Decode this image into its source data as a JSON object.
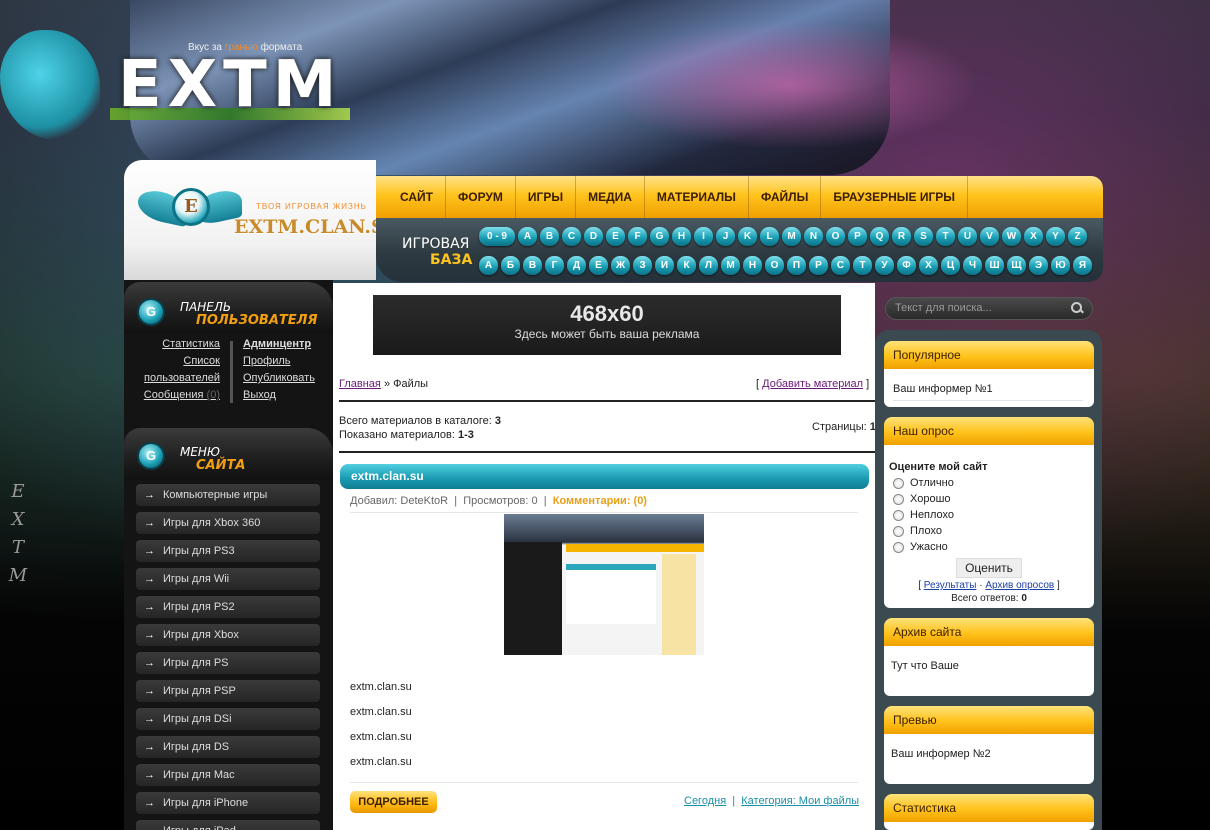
{
  "header": {
    "logo_text": "EXTM",
    "slogan_pre": "Вкус за",
    "slogan_hl": "гранью",
    "slogan_post": "формата",
    "side_letters": [
      "E",
      "X",
      "T",
      "M"
    ]
  },
  "brand": {
    "emblem_letter": "E",
    "tagline": "ТВОЯ ИГРОВАЯ ЖИЗНЬ",
    "url": "EXTM.CLAN.SU"
  },
  "nav": {
    "items": [
      "САЙТ",
      "ФОРУМ",
      "ИГРЫ",
      "МЕДИА",
      "МАТЕРИАЛЫ",
      "ФАЙЛЫ",
      "БРАУЗЕРНЫЕ ИГРЫ"
    ]
  },
  "gamebase": {
    "label_top": "ИГРОВАЯ",
    "label_bottom": "БАЗА",
    "latin": [
      "0 - 9",
      "A",
      "B",
      "C",
      "D",
      "E",
      "F",
      "G",
      "H",
      "I",
      "J",
      "K",
      "L",
      "M",
      "N",
      "O",
      "P",
      "Q",
      "R",
      "S",
      "T",
      "U",
      "V",
      "W",
      "X",
      "Y",
      "Z"
    ],
    "cyrillic": [
      "А",
      "Б",
      "В",
      "Г",
      "Д",
      "Е",
      "Ж",
      "З",
      "И",
      "К",
      "Л",
      "М",
      "Н",
      "О",
      "П",
      "Р",
      "С",
      "Т",
      "У",
      "Ф",
      "Х",
      "Ц",
      "Ч",
      "Ш",
      "Щ",
      "Э",
      "Ю",
      "Я"
    ]
  },
  "user_panel": {
    "title_top": "ПАНЕЛЬ",
    "title_bottom": "ПОЛЬЗОВАТЕЛЯ",
    "left_links": [
      "Статистика",
      "Список",
      "пользователей"
    ],
    "messages_label": "Сообщения",
    "messages_count": "(0)",
    "right_links": [
      "Админцентр",
      "Профиль",
      "Опубликовать",
      "Выход"
    ]
  },
  "menu": {
    "title_top": "МЕНЮ",
    "title_bottom": "САЙТА",
    "arrow": "→",
    "items": [
      "Компьютерные игры",
      "Игры для Xbox 360",
      "Игры для PS3",
      "Игры для Wii",
      "Игры для PS2",
      "Игры для Xbox",
      "Игры для PS",
      "Игры для PSP",
      "Игры для DSi",
      "Игры для DS",
      "Игры для Mac",
      "Игры для iPhone",
      "Игры для iPad"
    ]
  },
  "ad": {
    "size": "468x60",
    "text": "Здесь может быть ваша реклама"
  },
  "breadcrumb": {
    "home": "Главная",
    "sep": "»",
    "current": "Файлы"
  },
  "add_material": "Добавить материал",
  "catalog": {
    "total_label": "Всего материалов в каталоге:",
    "total": "3",
    "shown_label": "Показано материалов:",
    "shown": "1-3",
    "pages_label": "Страницы:",
    "pages": "1"
  },
  "entry": {
    "title": "extm.clan.su",
    "author_label": "Добавил:",
    "author": "DeteKtoR",
    "views_label": "Просмотров:",
    "views": "0",
    "comments": "Комментарии: (0)",
    "lines": [
      "extm.clan.su",
      "extm.clan.su",
      "extm.clan.su",
      "extm.clan.su"
    ],
    "more_label": "ПОДРОБНЕЕ",
    "date_link": "Сегодня",
    "category_link": "Категория: Мои файлы"
  },
  "search": {
    "placeholder": "Текст для поиска..."
  },
  "sidebar": {
    "popular_title": "Популярное",
    "popular_text": "Ваш информер №1",
    "poll_title": "Наш опрос",
    "poll_question": "Оцените мой сайт",
    "poll_options": [
      "Отлично",
      "Хорошо",
      "Неплохо",
      "Плохо",
      "Ужасно"
    ],
    "poll_button": "Оценить",
    "poll_results": "Результаты",
    "poll_archive": "Архив опросов",
    "poll_total_label": "Всего ответов:",
    "poll_total": "0",
    "archive_title": "Архив сайта",
    "archive_text": "Тут что Ваше",
    "preview_title": "Превью",
    "preview_text": "Ваш информер №2",
    "stats_title": "Статистика"
  }
}
